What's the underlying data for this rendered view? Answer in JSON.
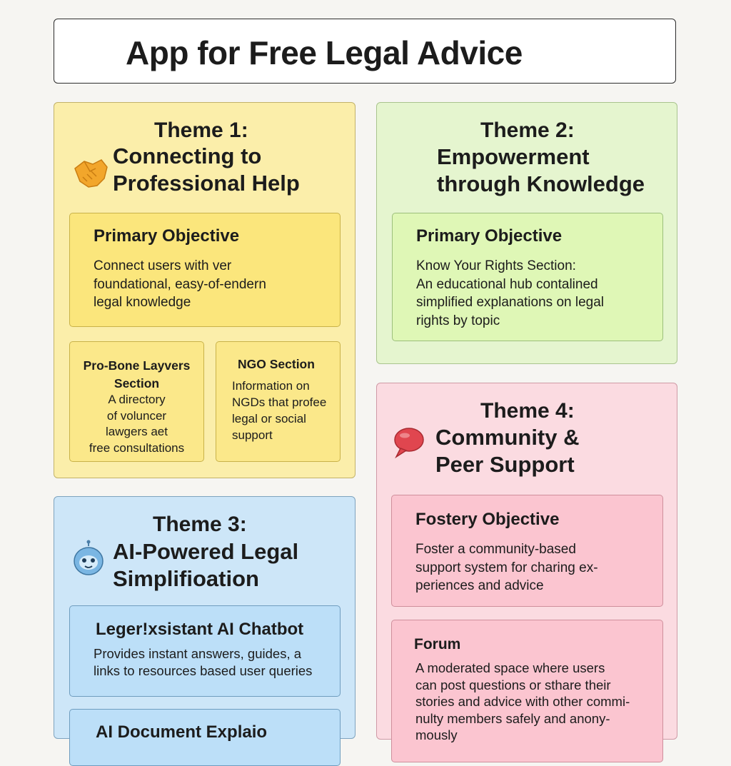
{
  "title": "App for Free Legal Advice",
  "themes": {
    "t1": {
      "number": "Theme 1:",
      "title_lines": [
        "Connecting to",
        "Professional Help"
      ],
      "icon": "handshake-icon",
      "objective": {
        "heading": "Primary Objective",
        "lines": [
          "Connect users with ver",
          "foundational, easy-of-endern",
          "legal knowledge"
        ]
      },
      "probono": {
        "heading_lines": [
          "Pro-Bone Layvers",
          "Section"
        ],
        "lines": [
          "A directory",
          "of voluncer",
          "lawgers aet",
          "free consultations"
        ]
      },
      "ngo": {
        "heading": "NGO Section",
        "lines": [
          "Information on",
          "NGDs that profee",
          "legal or social",
          "support"
        ]
      }
    },
    "t2": {
      "number": "Theme 2:",
      "title_lines": [
        "Empowerment",
        "through Knowledge"
      ],
      "objective": {
        "heading": "Primary Objective",
        "lines": [
          "Know Your Rights Section:",
          "An educational hub contalined",
          "simplified explanations on legal",
          "rights by topic"
        ]
      }
    },
    "t3": {
      "number": "Theme 3:",
      "title_lines": [
        "AI-Powered Legal",
        "Simplifioation"
      ],
      "icon": "robot-icon",
      "chatbot": {
        "heading": "Leger!xsistant AI Chatbot",
        "lines": [
          "Provides instant answers, guides, a",
          "links to resources based user queries"
        ]
      },
      "document": {
        "heading": "AI Document Explaio"
      }
    },
    "t4": {
      "number": "Theme 4:",
      "title_lines": [
        "Community &",
        "Peer Support"
      ],
      "icon": "speech-bubble-icon",
      "objective": {
        "heading": "Fostery Objective",
        "lines": [
          "Foster a community-based",
          "support system for charing ex-",
          "periences and advice"
        ]
      },
      "forum": {
        "heading": "Forum",
        "lines": [
          "A moderated space where users",
          "can post questions or sthare their",
          "stories and advice with other commi-",
          "nulty members safely and anony-",
          "mously"
        ]
      }
    }
  },
  "colors": {
    "theme1": "#fbeeaa",
    "theme2": "#e5f5cf",
    "theme3": "#cde6f8",
    "theme4": "#fbdbe1"
  }
}
